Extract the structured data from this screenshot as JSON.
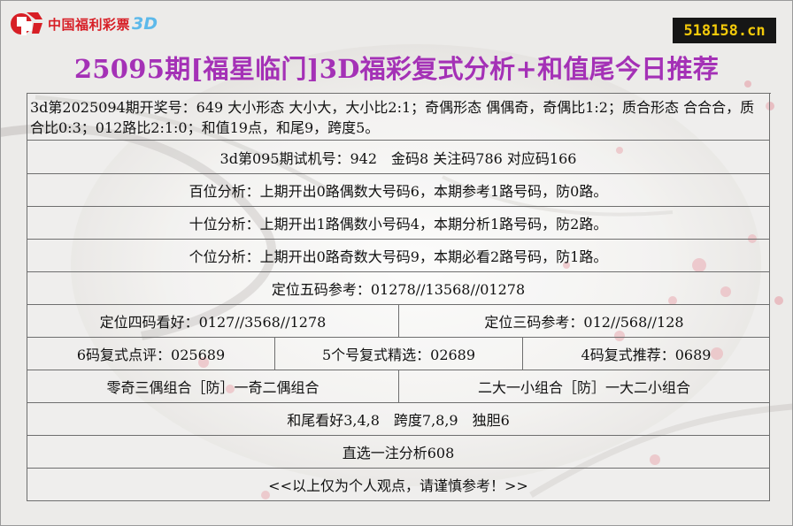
{
  "header": {
    "logo_text": "中国福利彩票",
    "logo_3d": "3D",
    "site_badge": "518158.cn",
    "title": "25095期[福星临门]3D福彩复式分析+和值尾今日推荐"
  },
  "colors": {
    "title": "#a431b6",
    "logo_red": "#d71f26",
    "logo_3d": "#5db9ea",
    "badge_bg": "#161616",
    "badge_text": "#f3c90a"
  },
  "rows": {
    "intro": "3d第2025094期开奖号：649 大小形态 大小大，大小比2:1；奇偶形态 偶偶奇，奇偶比1:2；质合形态 合合合，质合比0:3；012路比2:1:0；和值19点，和尾9，跨度5。",
    "trial": "3d第095期试机号：942　金码8 关注码786 对应码166",
    "hundreds": "百位分析：上期开出0路偶数大号码6，本期参考1路号码，防0路。",
    "tens": "十位分析：上期开出1路偶数小号码4，本期分析1路号码，防2路。",
    "units": "个位分析：上期开出0路奇数大号码9，本期必看2路号码，防1路。",
    "five_code": "定位五码参考：01278//13568//01278",
    "four_code": "定位四码看好：0127//3568//1278",
    "three_code": "定位三码参考：012//568//128",
    "six_compound": "6码复式点评：025689",
    "five_compound": "5个号复式精选：02689",
    "four_compound": "4码复式推荐：0689",
    "combo_left": "零奇三偶组合［防］一奇二偶组合",
    "combo_right": "二大一小组合［防］一大二小组合",
    "sum_tail": "和尾看好3,4,8　跨度7,8,9　独胆6",
    "direct": "直选一注分析608",
    "disclaimer": "<<以上仅为个人观点，请谨慎参考！>>"
  }
}
